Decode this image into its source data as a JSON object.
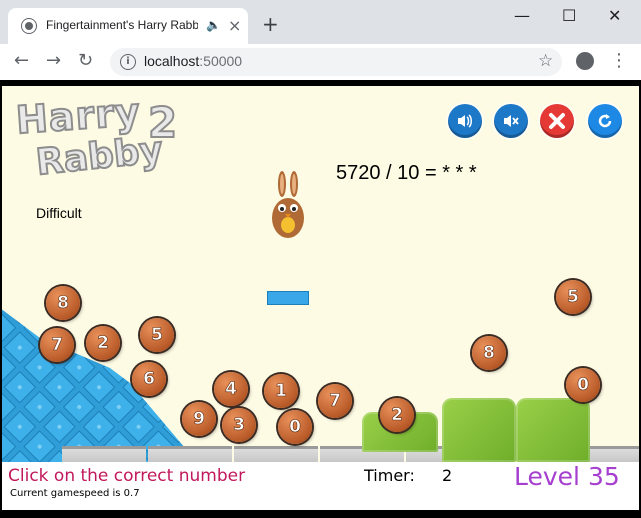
{
  "browser": {
    "tab_title": "Fingertainment's Harry Rabb",
    "new_tab": "+",
    "url_host": "localhost",
    "url_port": ":50000",
    "minimize": "—",
    "maximize": "☐",
    "close": "✕"
  },
  "game": {
    "logo": {
      "line1": "Harry",
      "line2": "Rabby",
      "number": "2"
    },
    "question": "5720 / 10 =  * * *",
    "difficulty": "Difficult",
    "balls": [
      "8",
      "7",
      "2",
      "5",
      "6",
      "4",
      "1",
      "9",
      "3",
      "0",
      "7",
      "2",
      "8",
      "5",
      "0"
    ],
    "status": {
      "instruction": "Click on the correct number",
      "speed": "Current gamespeed is 0.7",
      "timer_label": "Timer:",
      "timer_value": "2",
      "level": "Level 35"
    },
    "colors": {
      "stage_bg": "#fdfbe4",
      "instruction": "#c2185b",
      "level": "#a63fd0",
      "ball": "#b85a28",
      "control_blue": "#1e78c8",
      "control_red": "#e53935"
    },
    "icons": [
      "sound-on-icon",
      "sound-off-icon",
      "close-icon",
      "restart-icon"
    ]
  }
}
